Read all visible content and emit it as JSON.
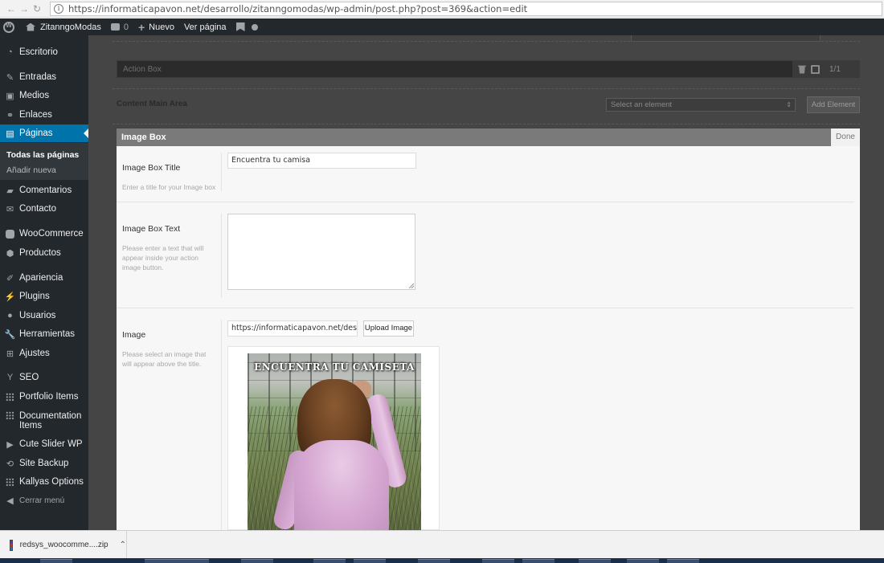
{
  "browser": {
    "url": "https://informaticapavon.net/desarrollo/zitanngomodas/wp-admin/post.php?post=369&action=edit"
  },
  "admin_bar": {
    "site_name": "ZitanngoModas",
    "comments_count": "0",
    "new_label": "Nuevo",
    "view_page_label": "Ver página"
  },
  "sidebar": {
    "items": [
      {
        "label": "Escritorio",
        "icon": "dashboard-icon"
      },
      {
        "label": "Entradas",
        "icon": "pin-icon"
      },
      {
        "label": "Medios",
        "icon": "media-icon"
      },
      {
        "label": "Enlaces",
        "icon": "link-icon"
      },
      {
        "label": "Páginas",
        "icon": "pages-icon"
      },
      {
        "label": "Comentarios",
        "icon": "comment-icon"
      },
      {
        "label": "Contacto",
        "icon": "mail-icon"
      },
      {
        "label": "WooCommerce",
        "icon": "woocommerce-icon"
      },
      {
        "label": "Productos",
        "icon": "products-icon"
      },
      {
        "label": "Apariencia",
        "icon": "brush-icon"
      },
      {
        "label": "Plugins",
        "icon": "plugin-icon"
      },
      {
        "label": "Usuarios",
        "icon": "users-icon"
      },
      {
        "label": "Herramientas",
        "icon": "wrench-icon"
      },
      {
        "label": "Ajustes",
        "icon": "settings-icon"
      },
      {
        "label": "SEO",
        "icon": "yoast-icon"
      },
      {
        "label": "Portfolio Items",
        "icon": "grid-icon"
      },
      {
        "label": "Documentation Items",
        "icon": "grid-icon"
      },
      {
        "label": "Cute Slider WP",
        "icon": "slider-icon"
      },
      {
        "label": "Site Backup",
        "icon": "backup-icon"
      },
      {
        "label": "Kallyas Options",
        "icon": "grid-icon"
      },
      {
        "label": "Cerrar menú",
        "icon": "collapse-icon"
      }
    ],
    "submenu": {
      "all_pages": "Todas las páginas",
      "add_new": "Añadir nueva"
    }
  },
  "builder": {
    "action_box_label": "Action Box",
    "pagination": "1/1",
    "content_main_area": "Content Main Area",
    "select_placeholder": "Select an element",
    "add_element": "Add Element"
  },
  "modal": {
    "title": "Image Box",
    "done": "Done",
    "title_field": {
      "label": "Image Box Title",
      "desc": "Enter a title for your Image box",
      "value": "Encuentra tu camisa"
    },
    "text_field": {
      "label": "Image Box Text",
      "desc": "Please enter a text that will appear inside your action image button.",
      "value": ""
    },
    "image_field": {
      "label": "Image",
      "desc": "Please select an image that will appear above the title.",
      "value": "https://informaticapavon.net/desarrol",
      "upload": "Upload Image",
      "preview_caption": "ENCUENTRA TU CAMISETA"
    }
  },
  "downloads": {
    "filename": "redsys_woocomme....zip"
  }
}
